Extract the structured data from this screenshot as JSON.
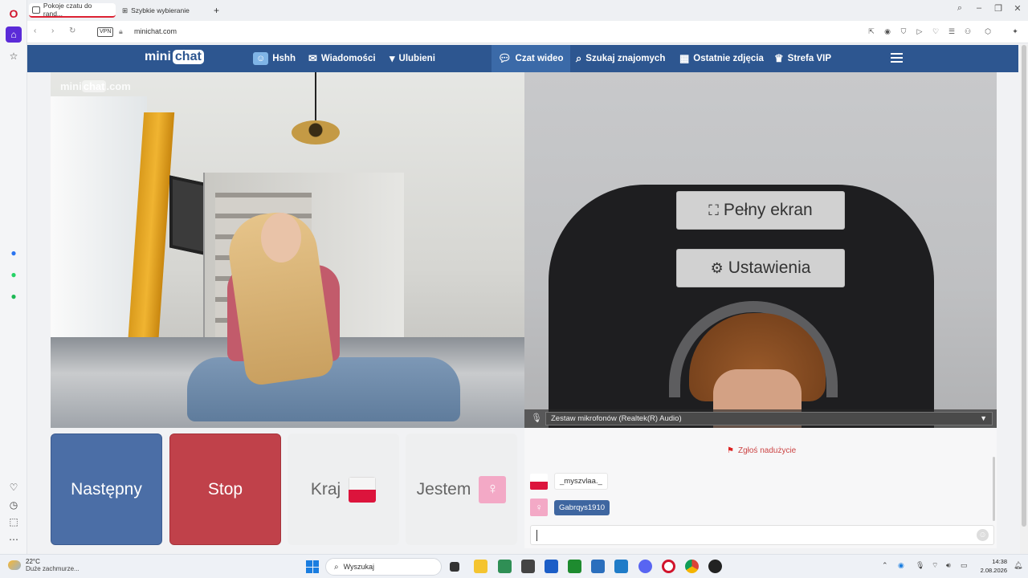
{
  "browser": {
    "tabs": [
      {
        "label": "Pokoje czatu do rand...",
        "active": true
      },
      {
        "label": "Szybkie wybieranie",
        "active": false
      }
    ],
    "new_tab": "+",
    "url": "minichat.com",
    "vpn_badge": "VPN"
  },
  "site": {
    "logo_mini": "mini",
    "logo_chat": "chat",
    "nav": [
      {
        "label": "Hshh",
        "icon": "avatar-icon"
      },
      {
        "label": "Wiadomości",
        "icon": "envelope-icon"
      },
      {
        "label": "Ulubieni",
        "icon": "bookmark-icon"
      },
      {
        "label": "Czat wideo",
        "icon": "chat-bubble-icon",
        "active": true
      },
      {
        "label": "Szukaj znajomych",
        "icon": "search-icon"
      },
      {
        "label": "Ostatnie zdjęcia",
        "icon": "grid-icon"
      },
      {
        "label": "Strefa VIP",
        "icon": "crown-icon"
      }
    ]
  },
  "video": {
    "watermark_left": "mini",
    "watermark_mid": "chat",
    "watermark_right": ".com",
    "fullscreen_label": "Pełny ekran",
    "settings_label": "Ustawienia",
    "mic_device": "Zestaw mikrofonów (Realtek(R) Audio)"
  },
  "controls": {
    "next_label": "Następny",
    "stop_label": "Stop",
    "country_label": "Kraj",
    "gender_label": "Jestem"
  },
  "chat": {
    "report_label": "Zgłoś nadużycie",
    "messages": [
      {
        "name": "_myszvlaa._"
      },
      {
        "name": "Gabrqys1910"
      }
    ]
  },
  "taskbar": {
    "temperature": "22°C",
    "weather_desc": "Duże zachmurze...",
    "search_placeholder": "Wyszukaj",
    "time": "14:38",
    "date": "2.08.2026"
  },
  "colors": {
    "nav_bg": "#2d5690",
    "next_btn": "#4b6ea6",
    "stop_btn": "#c0414a",
    "female_accent": "#f3a9c6"
  }
}
